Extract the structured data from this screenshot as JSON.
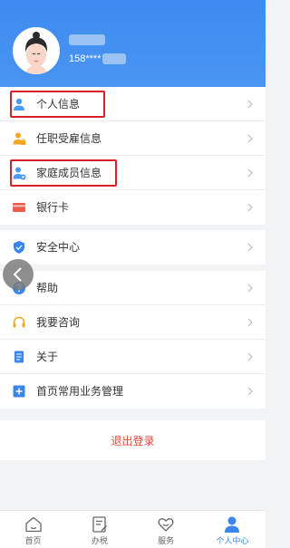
{
  "header": {
    "phone": "158****"
  },
  "groups": [
    {
      "items": [
        {
          "label": "个人信息",
          "icon": "person-icon",
          "color": "#4a9bf5"
        },
        {
          "label": "任职受雇信息",
          "icon": "employment-icon",
          "color": "#f5a623"
        },
        {
          "label": "家庭成员信息",
          "icon": "family-member-icon",
          "color": "#4a9bf5"
        },
        {
          "label": "银行卡",
          "icon": "bank-card-icon",
          "color": "#f05a4a"
        }
      ]
    },
    {
      "items": [
        {
          "label": "安全中心",
          "icon": "shield-icon",
          "color": "#3a86ee"
        }
      ]
    },
    {
      "items": [
        {
          "label": "帮助",
          "icon": "help-icon",
          "color": "#3a86ee"
        },
        {
          "label": "我要咨询",
          "icon": "headset-icon",
          "color": "#f5a623"
        },
        {
          "label": "关于",
          "icon": "document-icon",
          "color": "#3a86ee"
        },
        {
          "label": "首页常用业务管理",
          "icon": "plus-square-icon",
          "color": "#3a86ee"
        }
      ]
    }
  ],
  "logout_label": "退出登录",
  "tabbar": [
    {
      "label": "首页",
      "icon": "home-icon"
    },
    {
      "label": "办税",
      "icon": "tax-form-icon"
    },
    {
      "label": "服务",
      "icon": "heart-service-icon"
    },
    {
      "label": "个人中心",
      "icon": "user-profile-icon",
      "active": true
    }
  ],
  "colors": {
    "accent": "#3a86ee",
    "highlight_box": "#d9202a",
    "logout": "#e2493c"
  }
}
